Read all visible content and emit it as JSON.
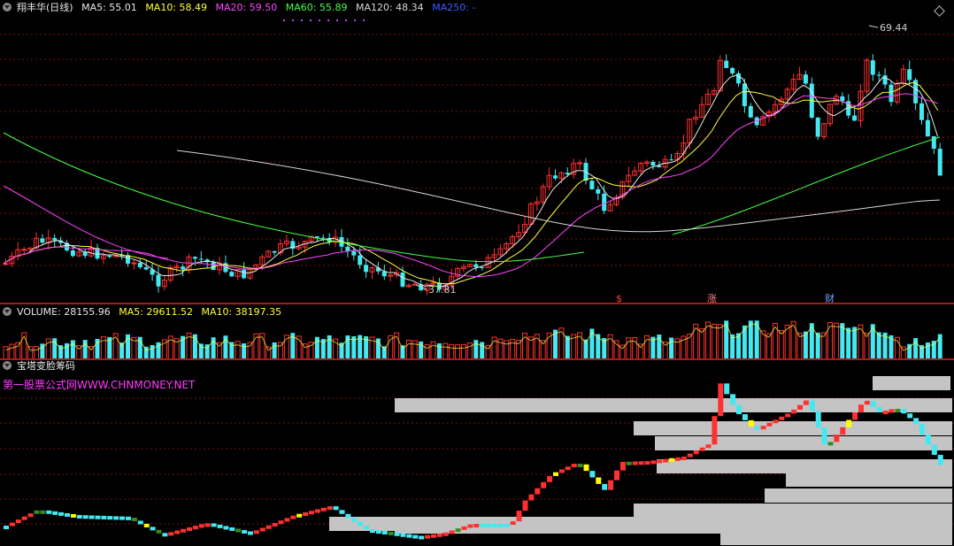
{
  "price_header": {
    "stock_name": "翔丰华(日线)",
    "ma": [
      {
        "label": "MA5: 55.01",
        "color": "#e8e8e8"
      },
      {
        "label": "MA10: 58.49",
        "color": "#ffff3c"
      },
      {
        "label": "MA20: 59.50",
        "color": "#ff44ff"
      },
      {
        "label": "MA60: 55.89",
        "color": "#44ff44"
      },
      {
        "label": "MA120: 48.34",
        "color": "#d8d8d8"
      },
      {
        "label": "MA250: -",
        "color": "#3a5cff"
      }
    ]
  },
  "price_labels": {
    "high": "69.44",
    "low": "37.81"
  },
  "event_tags": [
    {
      "text": "$",
      "color": "#ff4040"
    },
    {
      "text": "涨",
      "color": "#ff8080"
    },
    {
      "text": "财",
      "color": "#66aaff"
    }
  ],
  "volume_header": {
    "volume": "VOLUME: 28155.96",
    "ma5": "MA5: 29611.52",
    "ma10": "MA10: 38197.35",
    "colors": {
      "volume": "#e8e8e8",
      "ma5": "#ffff3c",
      "ma10": "#ffff3c"
    }
  },
  "chip_header": {
    "title": "宝塔变脸筹码",
    "site": "第一股票公式网WWW.CHNMONEY.NET"
  },
  "colors": {
    "up": "#ff3030",
    "down": "#44e8f0",
    "grid": "#7a1010",
    "chip_bar": "#c4c4c4",
    "yellow": "#ffff00",
    "green": "#3a8a20"
  }
}
